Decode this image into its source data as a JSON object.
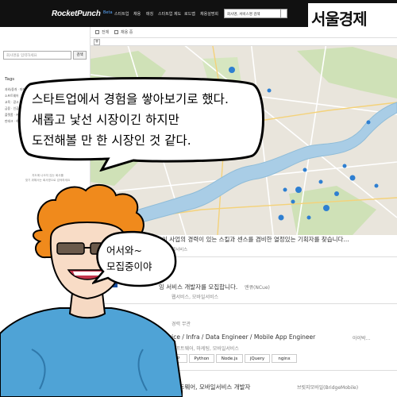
{
  "brand": {
    "logo": "RocketPunch",
    "beta": "Beta",
    "newspaper": "서울경제"
  },
  "nav": {
    "items": [
      "스타트업",
      "채용",
      "매칭",
      "스타트업 제도",
      "로드맵",
      "채용설명회"
    ],
    "search_value": "회사명, 서비스명 검색"
  },
  "sidebar": {
    "search_placeholder": "회사명을 입력하세요",
    "search_button": "검색",
    "tags_title": "Tags",
    "tag_lines": [
      "과외/중개 · 마케팅 · e-commerce · 패션 · 게임",
      "소프트웨어 · 빅데이터 · 개발 · 건강관 · 모바일",
      "교육 · 광고 · 음악 · 영화 · 스마트 · 디자인",
      "금융 · 인공지능 · 보안 · 여행 · 소셜 · 헬스케어",
      "플랫폼 · 커머스 · 서비스 · 로봇 · 미디어",
      "핀테크 · 하드웨어 · O2O · 데이터 · 부동산"
    ],
    "footer_1": "지도에 나오지 않는 회사를",
    "footer_2": "찾기 위해서는 회사명으로 검색하세요"
  },
  "map": {
    "tab_all": "전체",
    "tab_job": "채용 중"
  },
  "listing": {
    "job1_title": "이 사업의 경력이 있는 스킬과 센스를 겸비한 열정있는 기획자를 찾습니다...",
    "job1_tags": "웹서비스",
    "job2_title": "잉 서비스 개발자를 모집합니다.",
    "job2_company": "엔큐(NCue)",
    "job2_tags": "웹서비스, 모바일서비스",
    "section_label": "경력 무관",
    "job3_title": "ervice / Infra / Data Engineer / Mobile App Engineer",
    "job3_company": "아이박...",
    "job3_tags": "소프트웨어, 마케팅, 모바일서비스",
    "skills": [
      "PHP",
      "Python",
      "Node.js",
      "jQuery",
      "nginx"
    ],
    "job4_title": "스, 소프트웨어, 모바일서비스 개발자",
    "job4_company": "브릿지모바일(BridgeMobile)"
  },
  "comic": {
    "speech_line1": "스타트업에서 경험을 쌓아보기로 했다.",
    "speech_line2": "새롭고 낯선 시장이긴 하지만",
    "speech_line3": "도전해볼 만 한 시장인 것 같다.",
    "small_line1": "어서와~",
    "small_line2": "모집중이야"
  }
}
